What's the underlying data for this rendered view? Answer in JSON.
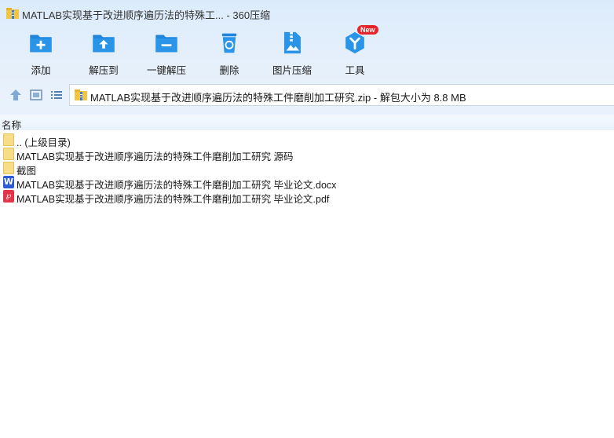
{
  "window": {
    "title": "MATLAB实现基于改进顺序遍历法的特殊工... - 360压缩"
  },
  "toolbar": {
    "items": [
      {
        "label": "添加",
        "icon": "add-file-icon"
      },
      {
        "label": "解压到",
        "icon": "extract-to-icon"
      },
      {
        "label": "一键解压",
        "icon": "one-click-extract-icon"
      },
      {
        "label": "删除",
        "icon": "trash-icon"
      },
      {
        "label": "图片压缩",
        "icon": "image-compress-icon"
      },
      {
        "label": "工具",
        "icon": "tools-icon"
      }
    ],
    "new_badge": "New"
  },
  "nav": {
    "path": "MATLAB实现基于改进顺序遍历法的特殊工件磨削加工研究.zip - 解包大小为 8.8 MB"
  },
  "list": {
    "column_name": "名称",
    "rows": [
      {
        "name": ".. (上级目录)",
        "type": "folder"
      },
      {
        "name": "MATLAB实现基于改进顺序遍历法的特殊工件磨削加工研究 源码",
        "type": "folder"
      },
      {
        "name": "截图",
        "type": "folder"
      },
      {
        "name": "MATLAB实现基于改进顺序遍历法的特殊工件磨削加工研究 毕业论文.docx",
        "type": "docx"
      },
      {
        "name": "MATLAB实现基于改进顺序遍历法的特殊工件磨削加工研究 毕业论文.pdf",
        "type": "pdf"
      }
    ]
  },
  "colors": {
    "accent": "#2a8fe0",
    "topbar_bg": "#e3eefb",
    "folder": "#f7dc8a",
    "word": "#2c5bd8",
    "pdf": "#e2354a",
    "badge": "#e8252b"
  }
}
